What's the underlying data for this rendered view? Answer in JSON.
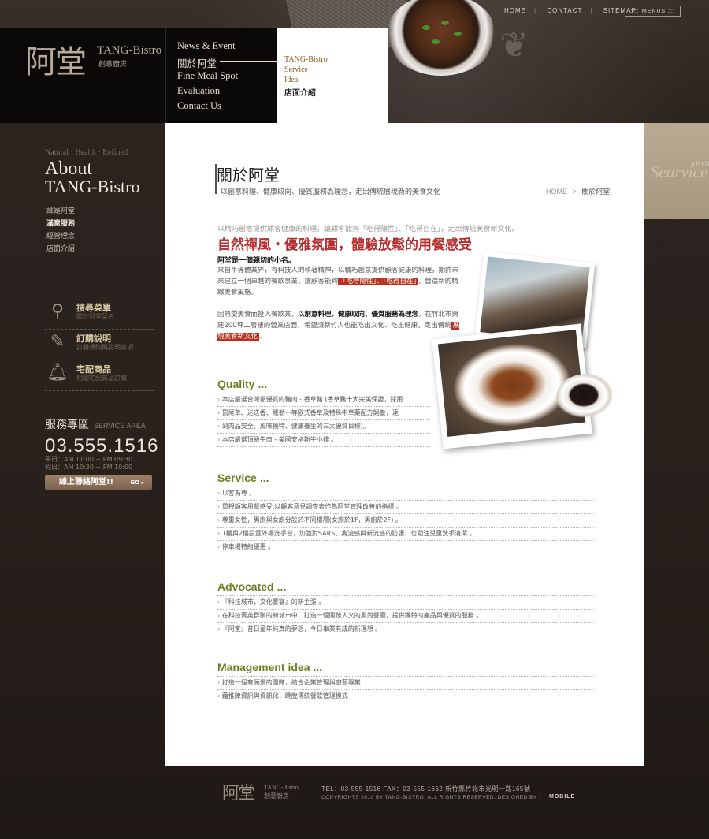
{
  "top_links": [
    "HOME",
    "CONTACT",
    "SITEMAP"
  ],
  "menus_label": ":::: MENUS :::",
  "logo": {
    "zh": "阿堂",
    "en": "TANG-Bistro",
    "sub": "創意廚房"
  },
  "main_nav": [
    "News & Event",
    "關於阿堂",
    "Fine Meal Spot",
    "Evaluation",
    "Contact Us"
  ],
  "sub_nav": [
    "TANG-Bistro",
    "Service",
    "Idea",
    "店面介紹"
  ],
  "right_tab": {
    "small": "ABOUT",
    "big": "Searvice"
  },
  "sidebar": {
    "tagline": "Natural · Health · Refined",
    "about_line1": "About",
    "about_line2": "TANG-Bistro",
    "links": [
      "誰是阿堂",
      "滿意服務",
      "經營理念",
      "店面介紹"
    ],
    "services": [
      {
        "title": "搜尋菜單",
        "sub": "關於阿堂菜色",
        "icon": "search-icon"
      },
      {
        "title": "訂購說明",
        "sub": "訂購規則與說明事項",
        "icon": "notepad-icon"
      },
      {
        "title": "宅配商品",
        "sub": "相關宅配商品訂購",
        "icon": "bell-icon"
      }
    ],
    "area_title": "服務專區",
    "area_en": "SERVICE AREA",
    "phone": "03.555.1516",
    "hours1": "平日：AM 11:00 ~ PM 09:30",
    "hours2": "假日：AM 10:30 ~ PM 10:00",
    "contact_btn": "線上聯絡阿堂!!",
    "go": "GO ▸"
  },
  "content": {
    "title": "關於阿堂",
    "subtitle": "以創意料理、健康取向、優質服務為理念，走出傳統展現新的美食文化",
    "breadcrumb_home": "HOME",
    "breadcrumb_sep": ">",
    "breadcrumb_cur": "關於阿堂",
    "intro": "以精巧創意提供顧客健康的料理，讓顧客能夠「吃得隨性」、「吃得自在」，走出傳統美食新文化。",
    "slogan": "自然禪風・優雅氛圍，體驗放鬆的用餐感受",
    "lead": "阿堂是一個親切的小名。",
    "p1a": "來自半導體業界，有科技人的執著精神，以精巧創意提供顧客健康的料理，期許未來建立一個卓越的餐飲事業，讓顧客能夠",
    "p1hl": "「吃得隨性」、「吃得自在」",
    "p1b": "，營造新的精緻美食風格。",
    "p2a": "因熱愛美食而投入餐飲業，",
    "p2b": "以創意料理、健康取向、優質服務為理念",
    "p2c": "，在竹北市興建200坪二層樓的營業店面，希望讓新竹人也能吃出文化、吃出健康，走出傳統",
    "p2hl": "展現美食新文化",
    "p2d": "。"
  },
  "sections": [
    {
      "title": "Quality",
      "dots": "...",
      "rows": [
        "本店嚴選台灣最優質的豬肉 - 香草豬 (香草豬十大完美保證，採用",
        "鼠尾草、迷迭香、羅勒⋯等歐式香草及特殊中草藥配方飼養，達",
        "到肉品安全、風味獨特、健康養生的三大優質目標)。",
        "本店嚴選頂級牛肉 - 美國安格斯牛小排 。"
      ]
    },
    {
      "title": "Service",
      "dots": "...",
      "rows": [
        "以客為尊 。",
        "重視顧客用餐感受,以顧客意見調查表作為阿堂管理改善的指標 。",
        "尊重女性，男廁與女廁分設於不同樓層(女廁於1F，男廁於2F) 。",
        "1樓與2樓設置外場洗手台，加強對SARS、禽流感與新流感的防護，也關注兒童洗手清潔 。",
        "停車場特約優惠 。"
      ]
    },
    {
      "title": "Advocated",
      "dots": "...",
      "rows": [
        "『科技城市，文化饗宴』的新主張 。",
        "在科技菁英群聚的新城市中，打造一個關懷人文的風尚餐廳，提供獨特的產品與優質的服務 。",
        "『阿堂』昔日童年純真的夢想，今日事業有成的新理想 。"
      ]
    },
    {
      "title": "Management  idea",
      "dots": "...",
      "rows": [
        "打造一個有願景的團隊，結合企業管理與廚藝專業",
        "藉推陳資訊與資訊化，跳脫傳統餐飲管理模式"
      ]
    }
  ],
  "footer": {
    "logo_zh": "阿堂",
    "logo_en": "TANG-Bistro",
    "logo_sub": "創意廚房",
    "info": "TEL：03-555-1516    FAX：03-555-1662    新竹縣竹北市光明一路165號",
    "copyright": "COPYRIGHTS 2010 BY TANG-BISTRO.    ALL RIGHTS RESERVED.         DESIGNED BY :",
    "designer": "MOBILE"
  }
}
